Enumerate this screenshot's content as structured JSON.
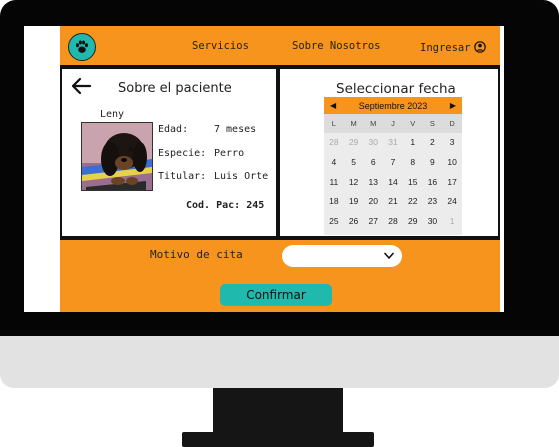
{
  "nav": {
    "links": [
      "Servicios",
      "Sobre Nosotros"
    ],
    "login_label": "Ingresar"
  },
  "patient": {
    "title": "Sobre el paciente",
    "name": "Leny",
    "age_label": "Edad:",
    "age_value": "7 meses",
    "species_label": "Especie:",
    "species_value": "Perro",
    "owner_label": "Titular:",
    "owner_value": "Luis Orte",
    "code_label": "Cod. Pac:",
    "code_value": "245"
  },
  "date_picker": {
    "title": "Seleccionar fecha",
    "month_label": "Septiembre 2023",
    "weekdays": [
      "L",
      "M",
      "M",
      "J",
      "V",
      "S",
      "D"
    ],
    "weeks": [
      [
        {
          "d": "28",
          "m": true
        },
        {
          "d": "29",
          "m": true
        },
        {
          "d": "30",
          "m": true
        },
        {
          "d": "31",
          "m": true
        },
        {
          "d": "1",
          "m": false
        },
        {
          "d": "2",
          "m": false
        },
        {
          "d": "3",
          "m": false
        }
      ],
      [
        {
          "d": "4",
          "m": false
        },
        {
          "d": "5",
          "m": false
        },
        {
          "d": "6",
          "m": false
        },
        {
          "d": "7",
          "m": false
        },
        {
          "d": "8",
          "m": false
        },
        {
          "d": "9",
          "m": false
        },
        {
          "d": "10",
          "m": false
        }
      ],
      [
        {
          "d": "11",
          "m": false
        },
        {
          "d": "12",
          "m": false
        },
        {
          "d": "13",
          "m": false
        },
        {
          "d": "14",
          "m": false
        },
        {
          "d": "15",
          "m": false
        },
        {
          "d": "16",
          "m": false
        },
        {
          "d": "17",
          "m": false
        }
      ],
      [
        {
          "d": "18",
          "m": false
        },
        {
          "d": "19",
          "m": false
        },
        {
          "d": "20",
          "m": false
        },
        {
          "d": "21",
          "m": false
        },
        {
          "d": "22",
          "m": false
        },
        {
          "d": "23",
          "m": false
        },
        {
          "d": "24",
          "m": false
        }
      ],
      [
        {
          "d": "25",
          "m": false
        },
        {
          "d": "26",
          "m": false
        },
        {
          "d": "27",
          "m": false
        },
        {
          "d": "28",
          "m": false
        },
        {
          "d": "29",
          "m": false
        },
        {
          "d": "30",
          "m": false
        },
        {
          "d": "1",
          "m": true
        }
      ]
    ]
  },
  "appointment": {
    "reason_label": "Motivo de cita",
    "reason_value": "",
    "confirm_label": "Confirmar"
  },
  "colors": {
    "accent": "#f7941d",
    "teal": "#1fb9ad"
  }
}
